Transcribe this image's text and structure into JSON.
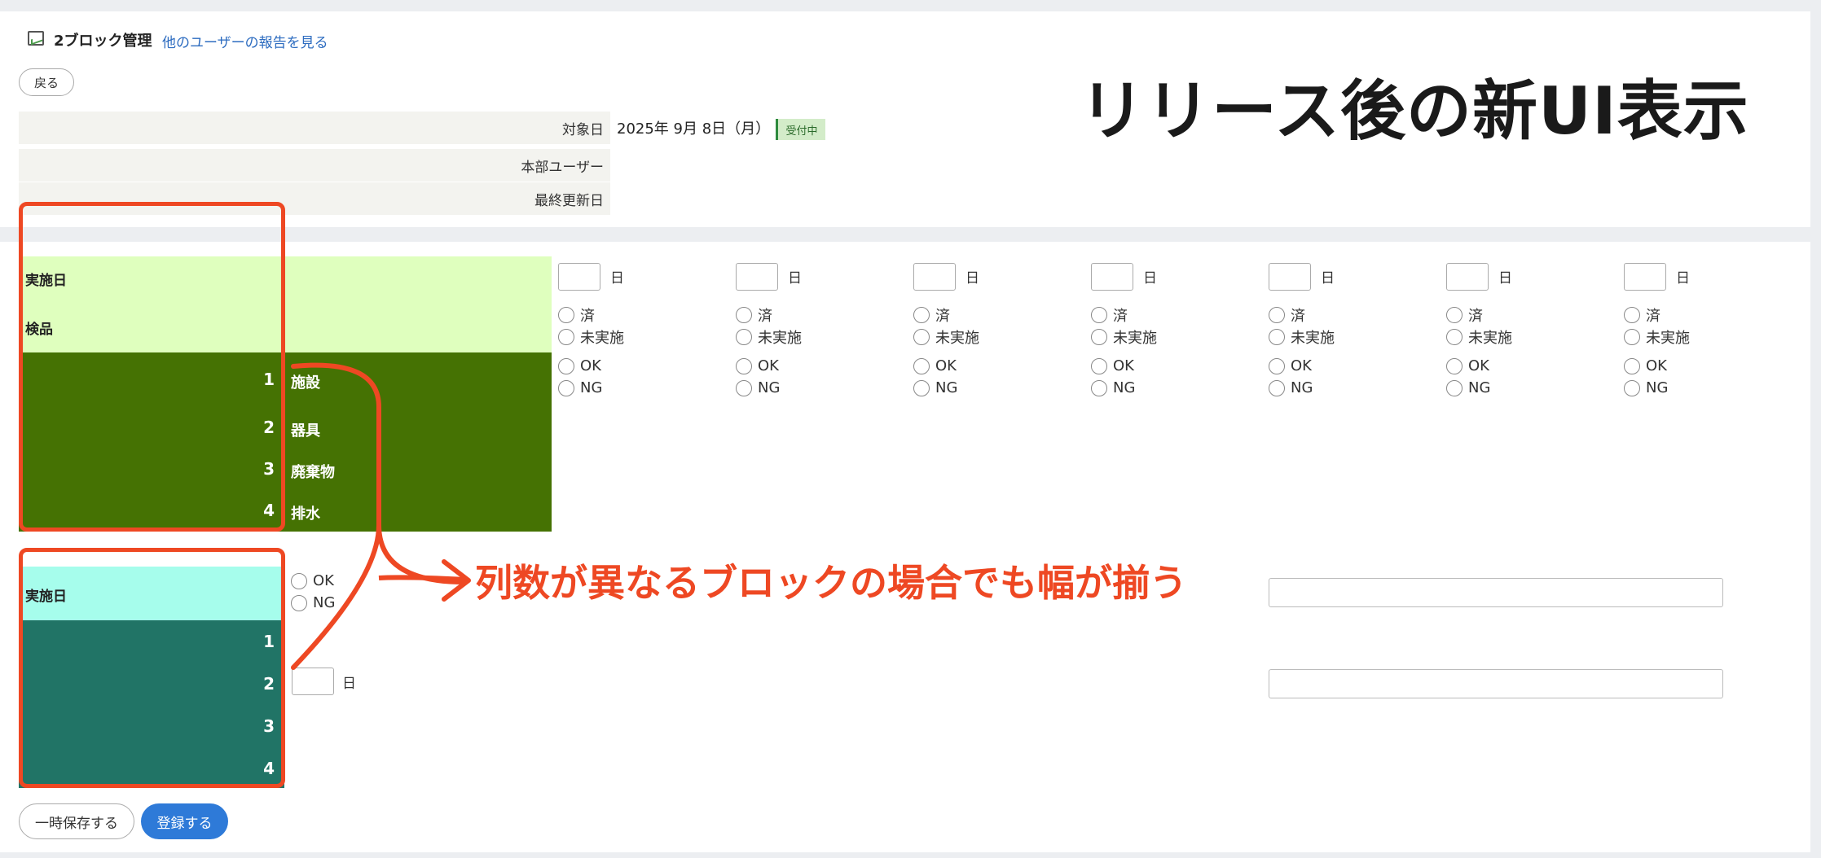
{
  "header": {
    "title": "2ブロック管理",
    "other_users_link": "他のユーザーの報告を見る",
    "back_label": "戻る",
    "hero_text": "リリース後の新UI表示"
  },
  "info": {
    "target_date_label": "対象日",
    "target_date_value": "2025年 9月 8日（月）",
    "status_badge": "受付中",
    "hq_user_label": "本部ユーザー",
    "last_updated_label": "最終更新日"
  },
  "block1": {
    "date_label": "実施日",
    "inspection_label": "検品",
    "items": [
      {
        "num": "1",
        "label": "施設"
      },
      {
        "num": "2",
        "label": "器具"
      },
      {
        "num": "3",
        "label": "廃棄物"
      },
      {
        "num": "4",
        "label": "排水"
      }
    ],
    "day_suffix": "日",
    "radio_done": "済",
    "radio_not_done": "未実施",
    "radio_ok": "OK",
    "radio_ng": "NG"
  },
  "block2": {
    "date_label": "実施日",
    "items": [
      "1",
      "2",
      "3",
      "4"
    ],
    "radio_ok": "OK",
    "radio_ng": "NG",
    "day_suffix": "日"
  },
  "annotation": {
    "text": "列数が異なるブロックの場合でも幅が揃う"
  },
  "footer": {
    "save_draft_label": "一時保存する",
    "submit_label": "登録する"
  },
  "colors": {
    "accent_red": "#ee4823",
    "primary_blue": "#2e7ad8",
    "block1_header": "#dfffbe",
    "block1_body": "#457203",
    "block2_header": "#a6fdec",
    "block2_body": "#217466"
  }
}
